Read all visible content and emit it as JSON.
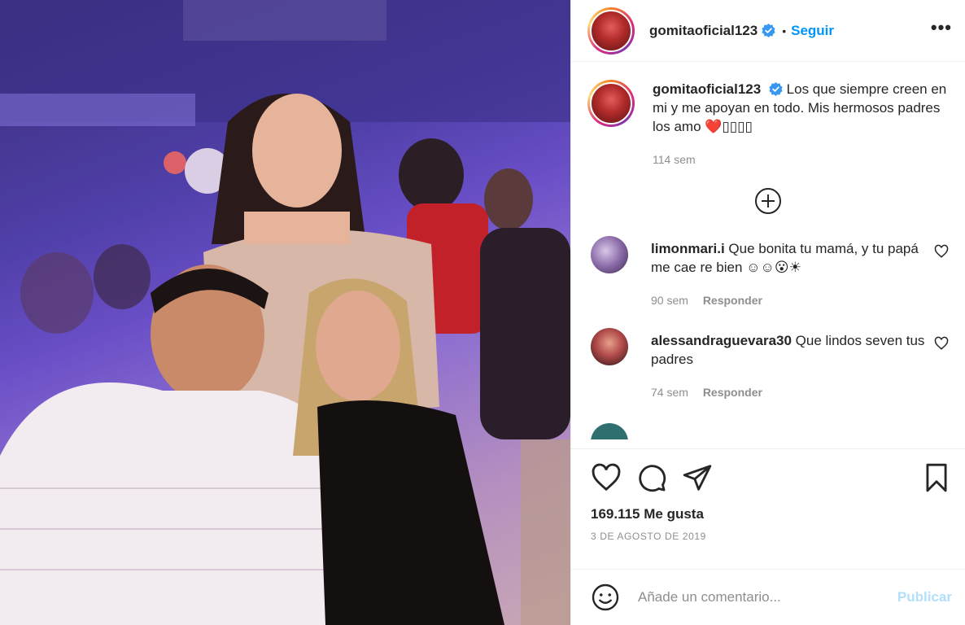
{
  "post": {
    "username": "gomitaoficial123",
    "follow_label": "Seguir",
    "more_label": "•••",
    "separator": "•"
  },
  "caption": {
    "username": "gomitaoficial123",
    "text": " Los que siempre creen en mi y me apoyan en todo. Mis hermosos padres los amo ❤️▯▯▯▯",
    "time": "114 sem"
  },
  "comments": [
    {
      "username": "limonmari.i",
      "text": " Que bonita tu mamá, y tu papá me cae re bien ☺☺😮☀",
      "time": "90 sem",
      "reply_label": "Responder"
    },
    {
      "username": "alessandraguevara30",
      "text": " Que lindos seven tus padres",
      "time": "74 sem",
      "reply_label": "Responder"
    }
  ],
  "likes_text": "169.115 Me gusta",
  "date_text": "3 DE AGOSTO DE 2019",
  "comment_input": {
    "placeholder": "Añade un comentario...",
    "publish_label": "Publicar"
  },
  "colors": {
    "accent": "#0095f6",
    "publish_disabled": "#b2dffc",
    "muted": "#8e8e8e"
  }
}
